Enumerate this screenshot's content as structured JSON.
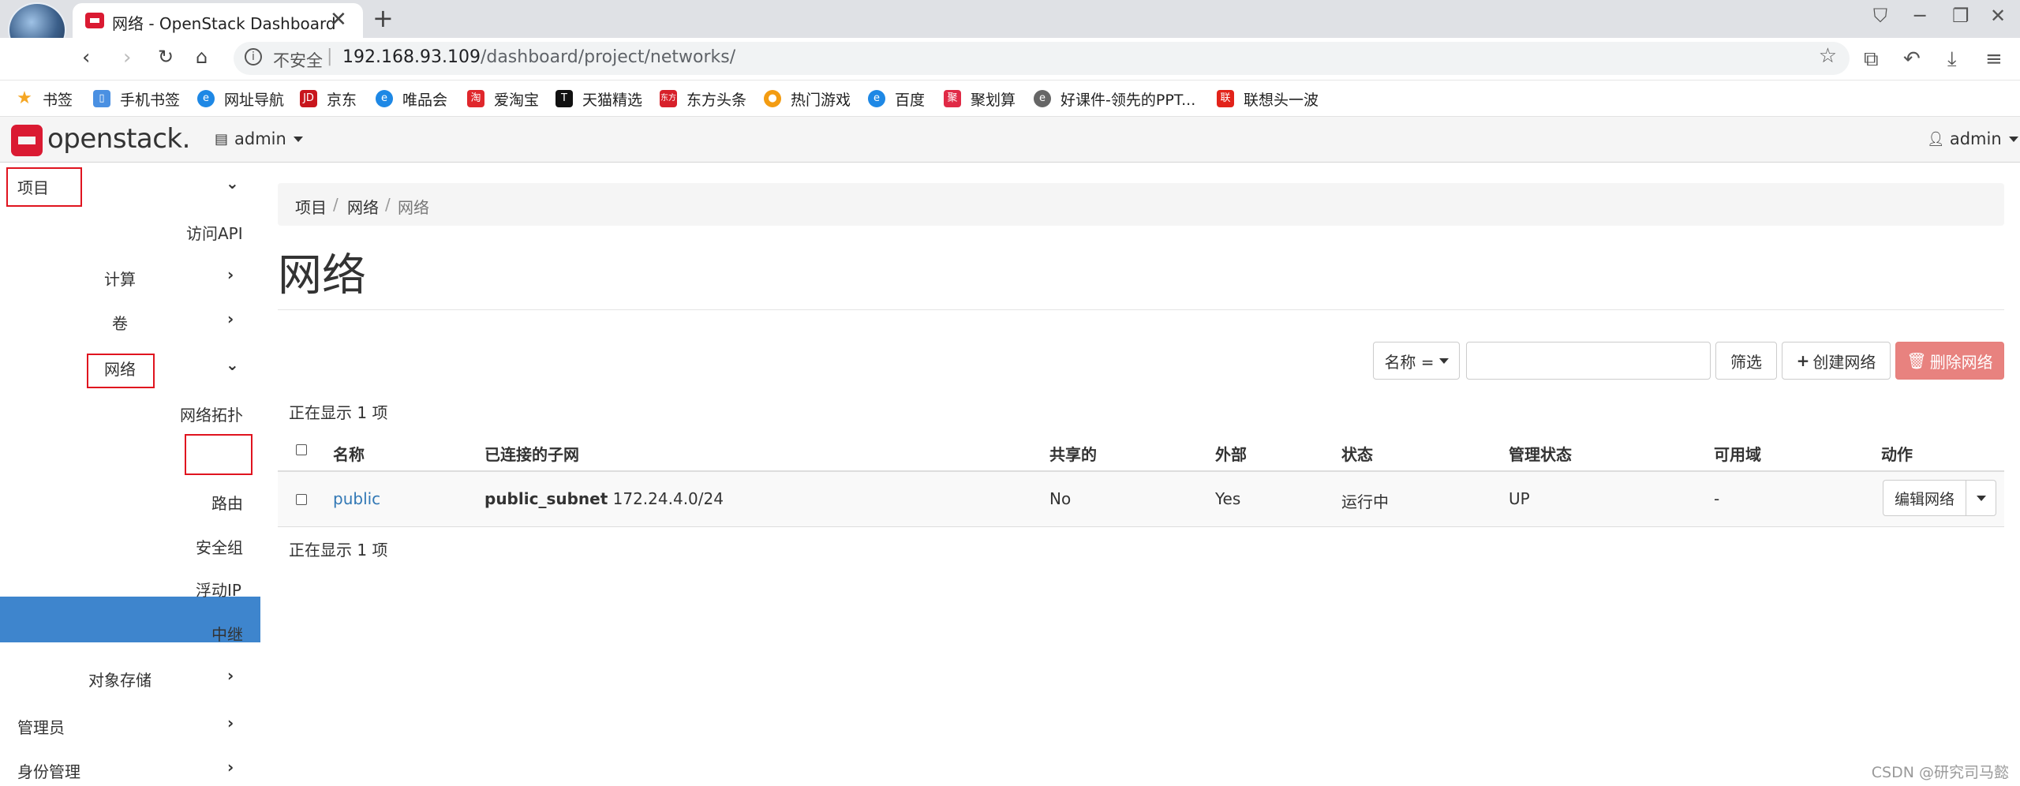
{
  "browser": {
    "tab_title": "网络 - OpenStack Dashboard",
    "tab_close": "✕",
    "new_tab": "+",
    "address": {
      "security_label": "不安全",
      "url_host": "192.168.93.109",
      "url_path": "/dashboard/project/networks/"
    },
    "bookmarks": [
      {
        "label": "书签",
        "icon": "star-icon",
        "color": "#f5a623"
      },
      {
        "label": "手机书签",
        "icon": "phone-icon",
        "color": "#4a90e2"
      },
      {
        "label": "网址导航",
        "icon": "e-icon",
        "color": "#1e88e5"
      },
      {
        "label": "京东",
        "icon": "jd-icon",
        "color": "#c8161d"
      },
      {
        "label": "唯品会",
        "icon": "e-icon",
        "color": "#1e88e5"
      },
      {
        "label": "爱淘宝",
        "icon": "taobao-icon",
        "color": "#e0272c"
      },
      {
        "label": "天猫精选",
        "icon": "tmall-icon",
        "color": "#111111"
      },
      {
        "label": "东方头条",
        "icon": "dongfang-icon",
        "color": "#d7202a"
      },
      {
        "label": "热门游戏",
        "icon": "game-icon",
        "color": "#f39c12"
      },
      {
        "label": "百度",
        "icon": "e-icon",
        "color": "#1e88e5"
      },
      {
        "label": "聚划算",
        "icon": "juhuasuan-icon",
        "color": "#e02a46"
      },
      {
        "label": "好课件-领先的PPT...",
        "icon": "haokejian-icon",
        "color": "#666666"
      },
      {
        "label": "联想头一波",
        "icon": "lenovo-icon",
        "color": "#e2231a"
      }
    ]
  },
  "header": {
    "logo_text": "openstack.",
    "project_selector": "admin",
    "user_menu": "admin"
  },
  "sidebar": {
    "project": "项目",
    "access_api": "访问API",
    "compute": "计算",
    "volumes": "卷",
    "network": "网络",
    "network_topology": "网络拓扑",
    "networks": "网络",
    "routers": "路由",
    "security_groups": "安全组",
    "floating_ips": "浮动IP",
    "trunks": "中继",
    "object_store": "对象存储",
    "admin": "管理员",
    "identity": "身份管理"
  },
  "breadcrumb": [
    "项目",
    "网络",
    "网络"
  ],
  "page_title": "网络",
  "toolbar": {
    "filter_field": "名称 =",
    "filter_button": "筛选",
    "create_button": "创建网络",
    "delete_button": "删除网络"
  },
  "table": {
    "count_text": "正在显示 1 项",
    "headers": [
      "名称",
      "已连接的子网",
      "共享的",
      "外部",
      "状态",
      "管理状态",
      "可用域",
      "动作"
    ],
    "rows": [
      {
        "name": "public",
        "subnet_name": "public_subnet",
        "subnet_cidr": "172.24.4.0/24",
        "shared": "No",
        "external": "Yes",
        "status": "运行中",
        "admin_state": "UP",
        "availability_zone": "-",
        "action": "编辑网络"
      }
    ]
  },
  "watermark": "CSDN @研究司马懿"
}
